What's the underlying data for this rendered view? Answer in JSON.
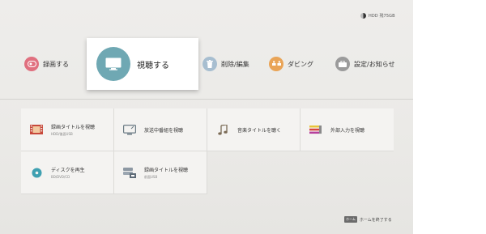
{
  "status": {
    "storage_label": "HDD 残75GB"
  },
  "top_menu": {
    "record": "録画する",
    "watch": "視聴する",
    "delete_edit": "削除/編集",
    "dubbing": "ダビング",
    "settings": "設定/お知らせ"
  },
  "tiles": [
    {
      "title": "録画タイトルを視聴",
      "subtitle": "HDD/後面USB",
      "icon": "film-icon"
    },
    {
      "title": "放送中番組を視聴",
      "subtitle": "",
      "icon": "tv-broadcast-icon"
    },
    {
      "title": "音楽タイトルを聴く",
      "subtitle": "",
      "icon": "music-note-icon"
    },
    {
      "title": "外部入力を視聴",
      "subtitle": "",
      "icon": "external-input-icon"
    },
    {
      "title": "ディスクを再生",
      "subtitle": "BD/DVD/CD",
      "icon": "disc-icon"
    },
    {
      "title": "録画タイトルを視聴",
      "subtitle": "前面USB",
      "icon": "usb-drive-icon"
    }
  ],
  "footer": {
    "key_label": "ホーム",
    "text": "ホームを終了する"
  },
  "colors": {
    "record": "#e0707f",
    "watch": "#6fa8b3",
    "delete": "#a7bed0",
    "dubbing": "#e9a457",
    "settings": "#9b9b9b"
  }
}
